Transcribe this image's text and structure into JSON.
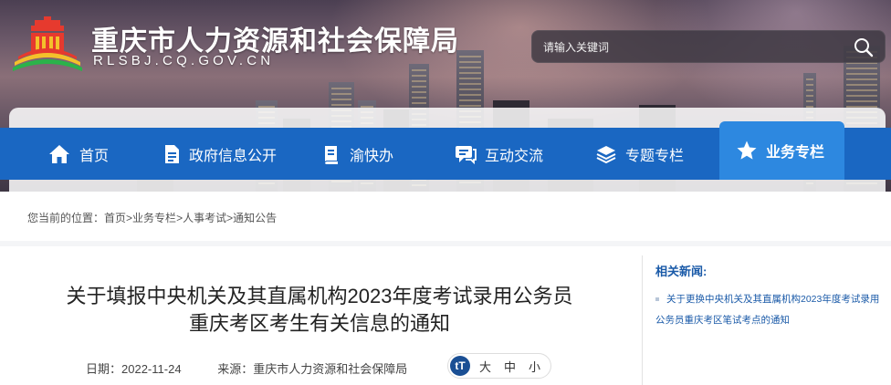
{
  "header": {
    "site_title": "重庆市人力资源和社会保障局",
    "site_domain": "RLSBJ.CQ.GOV.CN"
  },
  "search": {
    "placeholder": "请输入关键词"
  },
  "nav": {
    "items": [
      {
        "label": "首页",
        "icon": "home-icon"
      },
      {
        "label": "政府信息公开",
        "icon": "document-icon"
      },
      {
        "label": "渝快办",
        "icon": "book-icon"
      },
      {
        "label": "互动交流",
        "icon": "chat-icon"
      },
      {
        "label": "专题专栏",
        "icon": "layers-icon"
      },
      {
        "label": "业务专栏",
        "icon": "star-icon",
        "active": true
      }
    ]
  },
  "breadcrumb": {
    "prefix": "您当前的位置：",
    "items": [
      "首页",
      "业务专栏",
      "人事考试",
      "通知公告"
    ],
    "separator": ">"
  },
  "article": {
    "title_line1": "关于填报中央机关及其直属机构2023年度考试录用公务员",
    "title_line2": "重庆考区考生有关信息的通知",
    "date_label": "日期：",
    "date": "2022-11-24",
    "source_label": "来源：",
    "source": "重庆市人力资源和社会保障局",
    "font_size_options": [
      "大",
      "中",
      "小"
    ]
  },
  "sidebar": {
    "title": "相关新闻:",
    "news": [
      "关于更换中央机关及其直属机构2023年度考试录用公务员重庆考区笔试考点的通知"
    ]
  },
  "colors": {
    "nav_blue": "#1a67c2",
    "nav_active": "#2d88e0",
    "link_blue": "#1a5aa8"
  }
}
